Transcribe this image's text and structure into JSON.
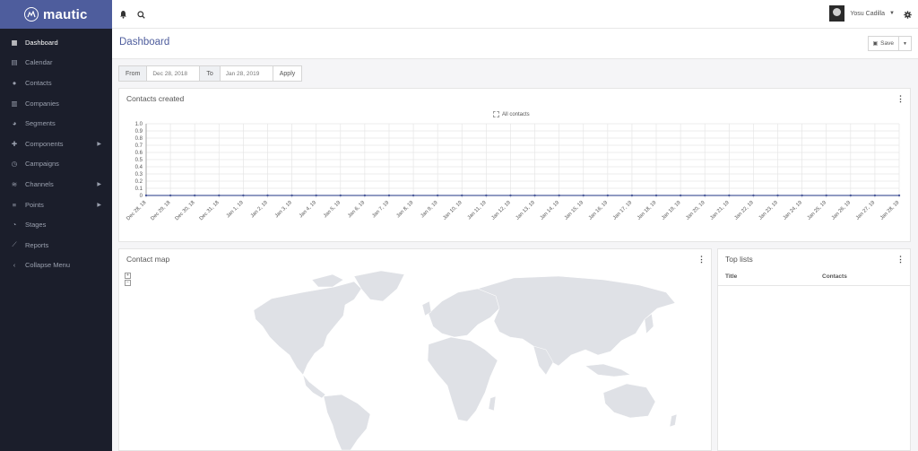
{
  "brand": {
    "name": "mautic"
  },
  "sidebar": {
    "items": [
      {
        "label": "Dashboard",
        "icon": "dashboard-icon",
        "active": true
      },
      {
        "label": "Calendar",
        "icon": "calendar-icon"
      },
      {
        "label": "Contacts",
        "icon": "user-icon"
      },
      {
        "label": "Companies",
        "icon": "building-icon"
      },
      {
        "label": "Segments",
        "icon": "pie-icon"
      },
      {
        "label": "Components",
        "icon": "puzzle-icon",
        "caret": true
      },
      {
        "label": "Campaigns",
        "icon": "clock-icon"
      },
      {
        "label": "Channels",
        "icon": "rss-icon",
        "caret": true
      },
      {
        "label": "Points",
        "icon": "sliders-icon",
        "caret": true
      },
      {
        "label": "Stages",
        "icon": "tachometer-icon"
      },
      {
        "label": "Reports",
        "icon": "line-chart-icon"
      },
      {
        "label": "Collapse Menu",
        "icon": "chevron-left-icon"
      }
    ]
  },
  "header": {
    "user_name": "Yosu Cadilla"
  },
  "page": {
    "title": "Dashboard",
    "save_label": "Save"
  },
  "date_filter": {
    "from_label": "From",
    "from_value": "Dec 28, 2018",
    "to_label": "To",
    "to_value": "Jan 28, 2019",
    "apply_label": "Apply"
  },
  "widgets": {
    "contacts_created": {
      "title": "Contacts created"
    },
    "contact_map": {
      "title": "Contact map",
      "zoom_in": "+",
      "zoom_out": "−"
    },
    "top_lists": {
      "title": "Top lists",
      "col_title": "Title",
      "col_contacts": "Contacts"
    }
  },
  "colors": {
    "brand": "#4e5d9d",
    "sidebar": "#1b1e2b",
    "map_land": "#dfe1e6",
    "axis": "#555555"
  },
  "chart_data": {
    "type": "line",
    "title": "",
    "legend": [
      "All contacts"
    ],
    "legend_position": "top-center",
    "grid": true,
    "ylim": [
      0,
      1.0
    ],
    "y_ticks": [
      "1.0",
      "0.9",
      "0.8",
      "0.7",
      "0.6",
      "0.5",
      "0.4",
      "0.3",
      "0.2",
      "0.1",
      "0"
    ],
    "x": [
      "Dec 28, 18",
      "Dec 29, 18",
      "Dec 30, 18",
      "Dec 31, 18",
      "Jan 1, 19",
      "Jan 2, 19",
      "Jan 3, 19",
      "Jan 4, 19",
      "Jan 5, 19",
      "Jan 6, 19",
      "Jan 7, 19",
      "Jan 8, 19",
      "Jan 9, 19",
      "Jan 10, 19",
      "Jan 11, 19",
      "Jan 12, 19",
      "Jan 13, 19",
      "Jan 14, 19",
      "Jan 15, 19",
      "Jan 16, 19",
      "Jan 17, 19",
      "Jan 18, 19",
      "Jan 19, 19",
      "Jan 20, 19",
      "Jan 21, 19",
      "Jan 22, 19",
      "Jan 23, 19",
      "Jan 24, 19",
      "Jan 25, 19",
      "Jan 26, 19",
      "Jan 27, 19",
      "Jan 28, 19"
    ],
    "series": [
      {
        "name": "All contacts",
        "values": [
          0,
          0,
          0,
          0,
          0,
          0,
          0,
          0,
          0,
          0,
          0,
          0,
          0,
          0,
          0,
          0,
          0,
          0,
          0,
          0,
          0,
          0,
          0,
          0,
          0,
          0,
          0,
          0,
          0,
          0,
          0,
          0
        ]
      }
    ]
  }
}
